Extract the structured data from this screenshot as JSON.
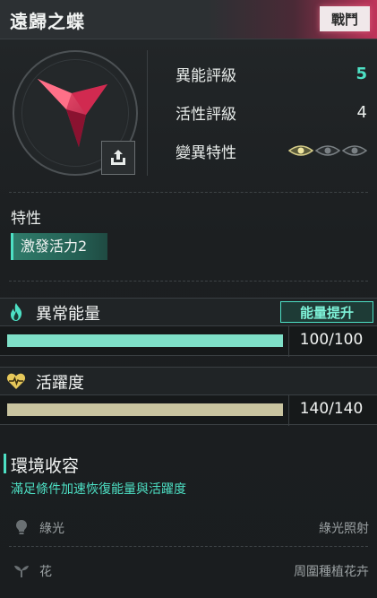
{
  "header": {
    "title": "遠歸之蝶",
    "mode_badge": "戰鬥",
    "accent_color": "#c0335a"
  },
  "emblem": {
    "icon": "red-butterfly-emblem",
    "export_icon": "export-icon"
  },
  "stats": [
    {
      "label": "異能評級",
      "value": "5",
      "accent": true
    },
    {
      "label": "活性評級",
      "value": "4",
      "accent": false
    },
    {
      "label": "變異特性",
      "eyes_active": 1,
      "eyes_total": 3
    }
  ],
  "trait": {
    "section_label": "特性",
    "chip": "激發活力2"
  },
  "energy": {
    "icon": "flame-icon",
    "label": "異常能量",
    "boost_label": "能量提升",
    "value_text": "100/100",
    "fraction": 1.0,
    "color": "#7fe0c8"
  },
  "vitality": {
    "icon": "heartbeat-icon",
    "label": "活躍度",
    "value_text": "140/140",
    "fraction": 1.0,
    "color": "#c9c4a0"
  },
  "environment": {
    "title": "環境收容",
    "description": "滿足條件加速恢復能量與活躍度",
    "rows": [
      {
        "icon": "bulb-icon",
        "name": "綠光",
        "condition": "綠光照射"
      },
      {
        "icon": "sprout-icon",
        "name": "花",
        "condition": "周圍種植花卉"
      }
    ]
  },
  "colors": {
    "accent": "#4de0c4",
    "panel": "#1a1d1f"
  }
}
